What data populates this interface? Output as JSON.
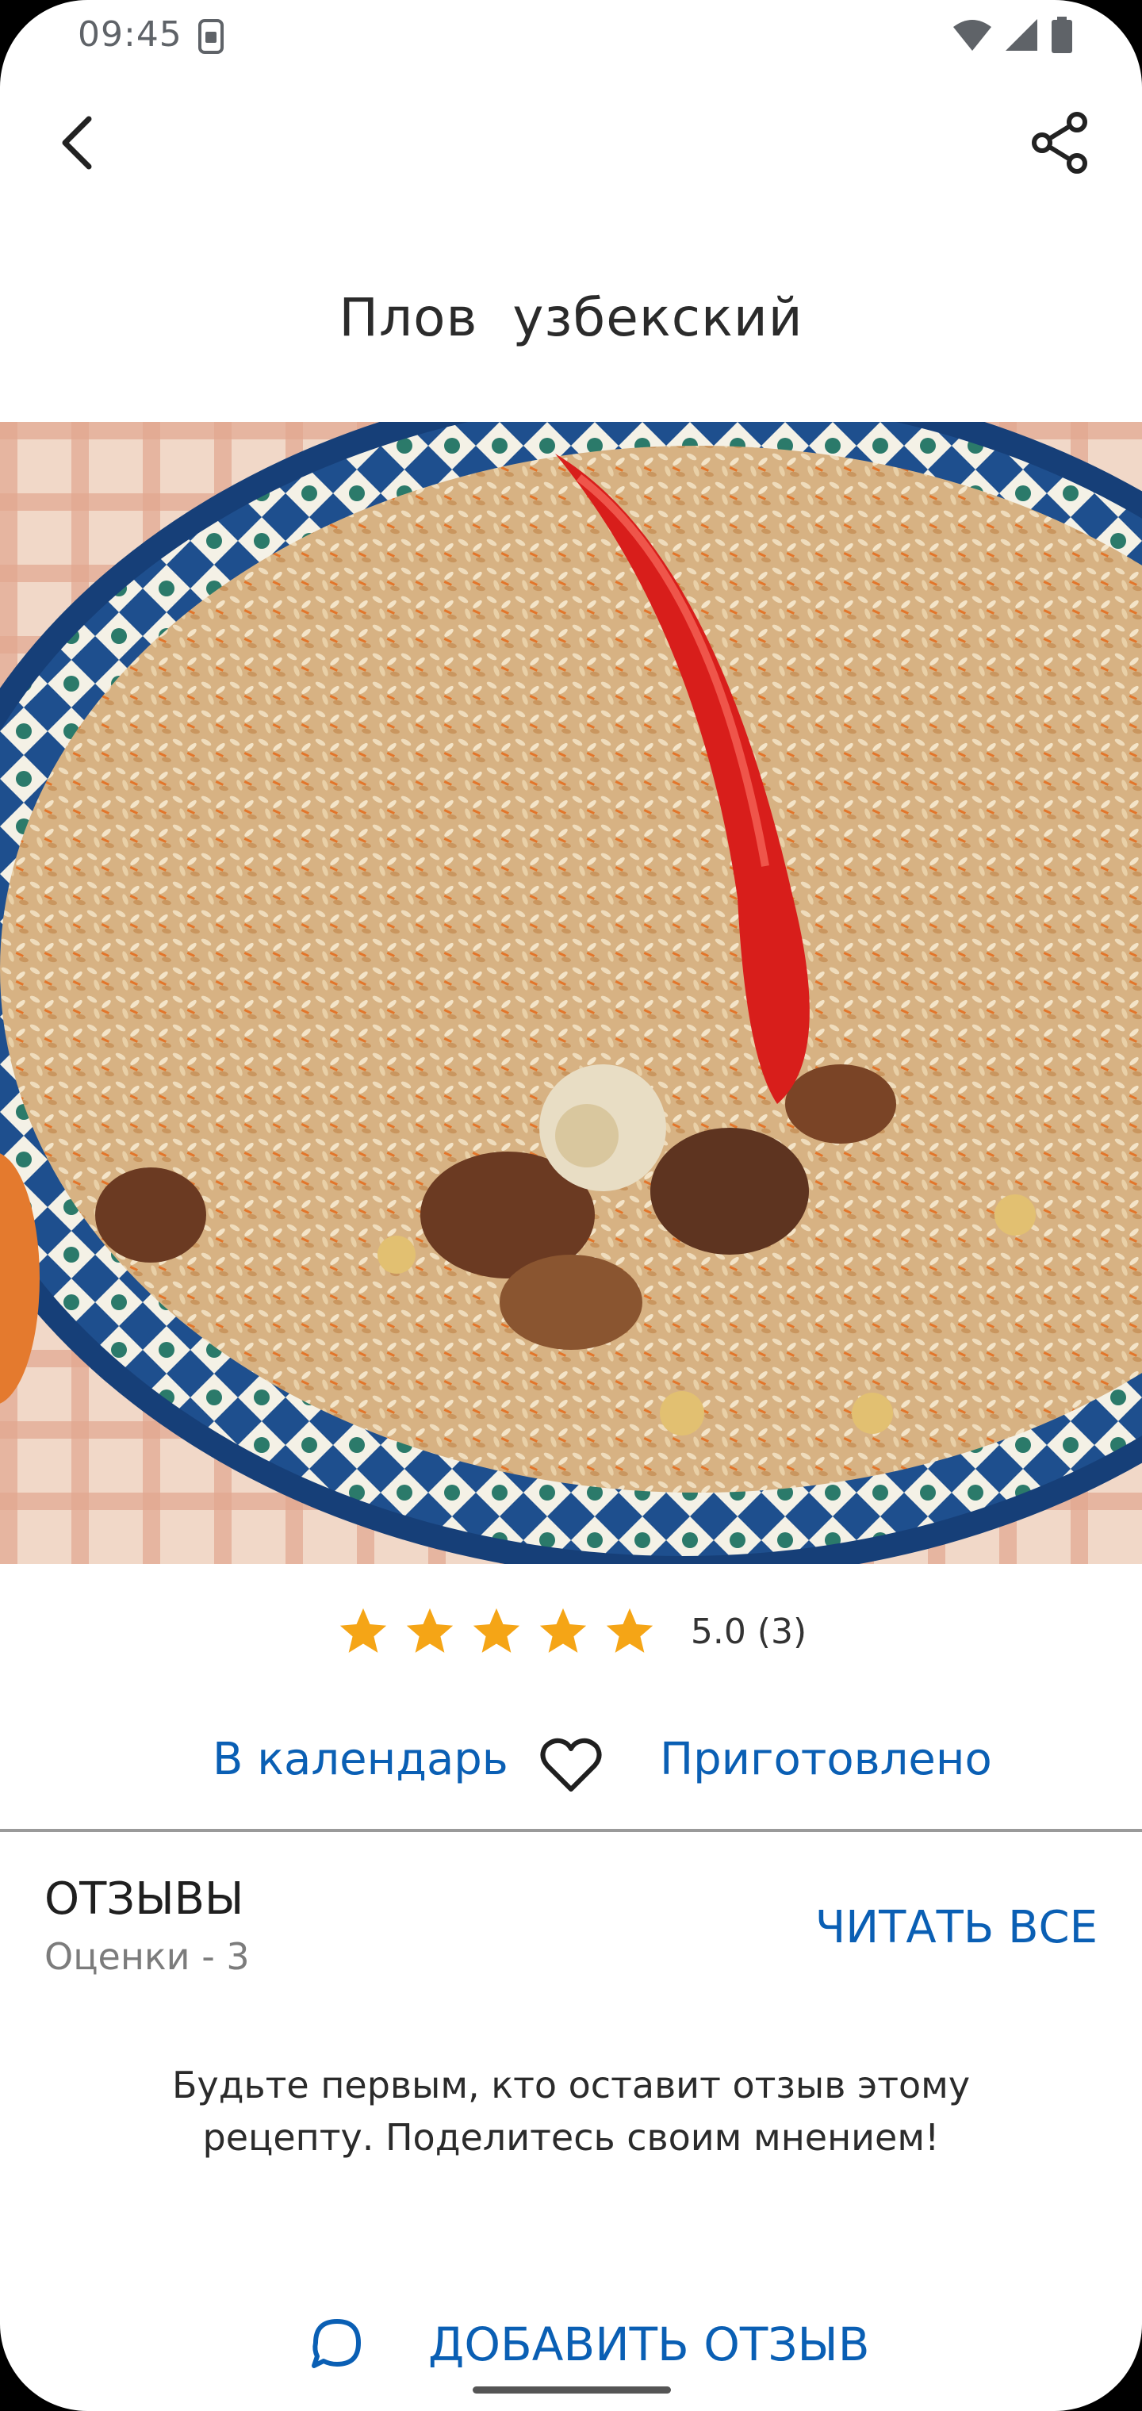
{
  "status_bar": {
    "time": "09:45",
    "icons": [
      "sim-icon",
      "wifi-icon",
      "signal-icon",
      "battery-icon"
    ]
  },
  "header": {
    "back_icon": "chevron-left-icon",
    "share_icon": "share-icon"
  },
  "recipe": {
    "title": "Плов  узбекский",
    "image": "plov-dish-photo"
  },
  "rating": {
    "stars_filled": 5,
    "stars_total": 5,
    "value_text": "5.0 (3)",
    "star_color": "#f5a516"
  },
  "actions": {
    "calendar_label": "В календарь",
    "favorite_icon": "heart-outline-icon",
    "cooked_label": "Приготовлено"
  },
  "reviews": {
    "title": "ОТЗЫВЫ",
    "subtitle": "Оценки - 3",
    "read_all_label": "ЧИТАТЬ ВСЕ",
    "empty_message": "Будьте первым, кто оставит отзыв этому рецепту. Поделитесь своим мнением!",
    "add_icon": "comment-bubble-icon",
    "add_label": "ДОБАВИТЬ ОТЗЫВ"
  },
  "colors": {
    "accent": "#0a5fb4",
    "text": "#2b2b2b",
    "muted": "#7c7c7c"
  }
}
